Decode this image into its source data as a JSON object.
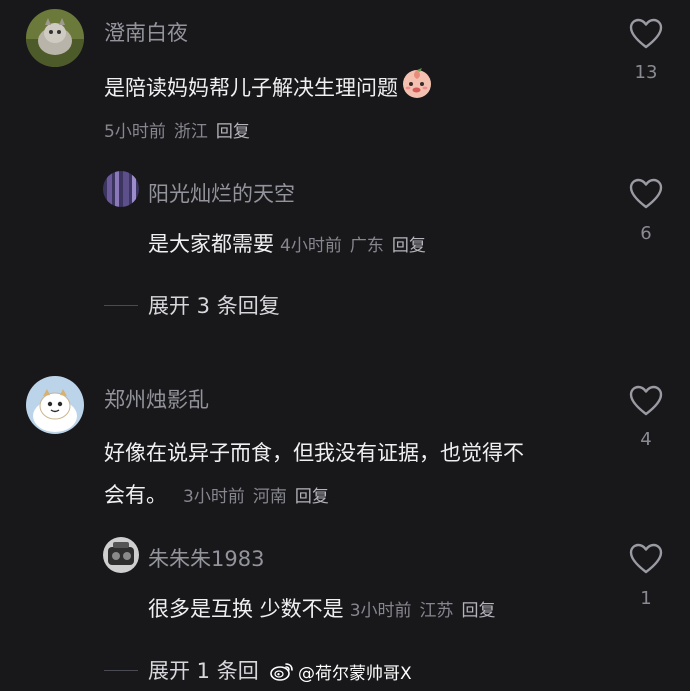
{
  "comments": [
    {
      "username": "澄南白夜",
      "text": "是陪读妈妈帮儿子解决生理问题",
      "emoji": "peach-face-emoji",
      "time": "5小时前",
      "location": "浙江",
      "reply_label": "回复",
      "likes": "13",
      "replies": [
        {
          "username": "阳光灿烂的天空",
          "text": "是大家都需要",
          "time": "4小时前",
          "location": "广东",
          "reply_label": "回复",
          "likes": "6"
        }
      ],
      "expand_label": "展开 3 条回复"
    },
    {
      "username": "郑州烛影乱",
      "text_line1": "好像在说异子而食，但我没有证据，也觉得不",
      "text_line2": "会有。",
      "time": "3小时前",
      "location": "河南",
      "reply_label": "回复",
      "likes": "4",
      "replies": [
        {
          "username": "朱朱朱1983",
          "text": "很多是互换 少数不是",
          "time": "3小时前",
          "location": "江苏",
          "reply_label": "回复",
          "likes": "1"
        }
      ],
      "expand_label": "展开 1 条回"
    }
  ],
  "watermark": {
    "text": "@荷尔蒙帅哥X",
    "icon": "weibo-icon"
  },
  "colors": {
    "background": "#18181b",
    "username": "#93939b",
    "text": "#f0f0f2",
    "meta": "#86868e"
  }
}
